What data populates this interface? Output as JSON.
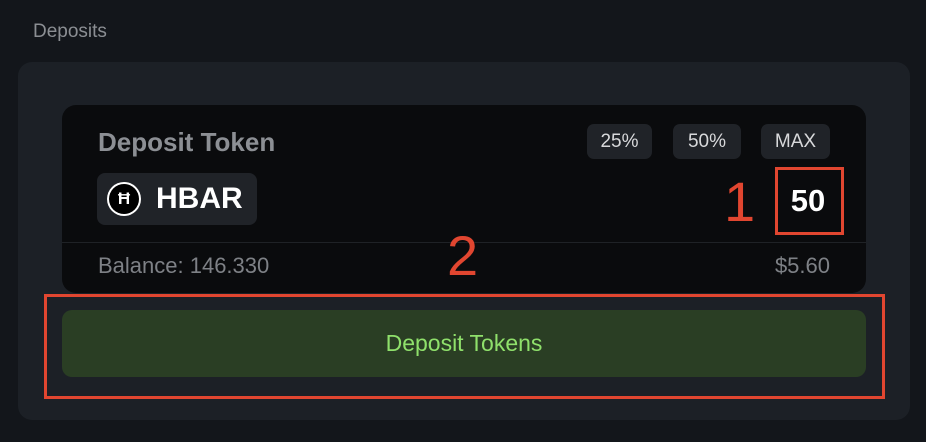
{
  "section": {
    "title": "Deposits"
  },
  "deposit_card": {
    "title": "Deposit Token",
    "percent_buttons": [
      "25%",
      "50%",
      "MAX"
    ],
    "token": {
      "icon": "hbar-logo-icon",
      "logo_glyph": "Ħ",
      "symbol": "HBAR"
    },
    "amount": "50",
    "balance_label": "Balance: 146.330",
    "usd_value": "$5.60"
  },
  "actions": {
    "deposit_label": "Deposit Tokens"
  },
  "annotations": {
    "labels": [
      "1",
      "2"
    ],
    "color": "#e14630"
  },
  "colors": {
    "background": "#13161b",
    "panel": "#1c2026",
    "card": "#0a0b0d",
    "button_bg": "#2a3e24",
    "button_text": "#8fe06b"
  }
}
